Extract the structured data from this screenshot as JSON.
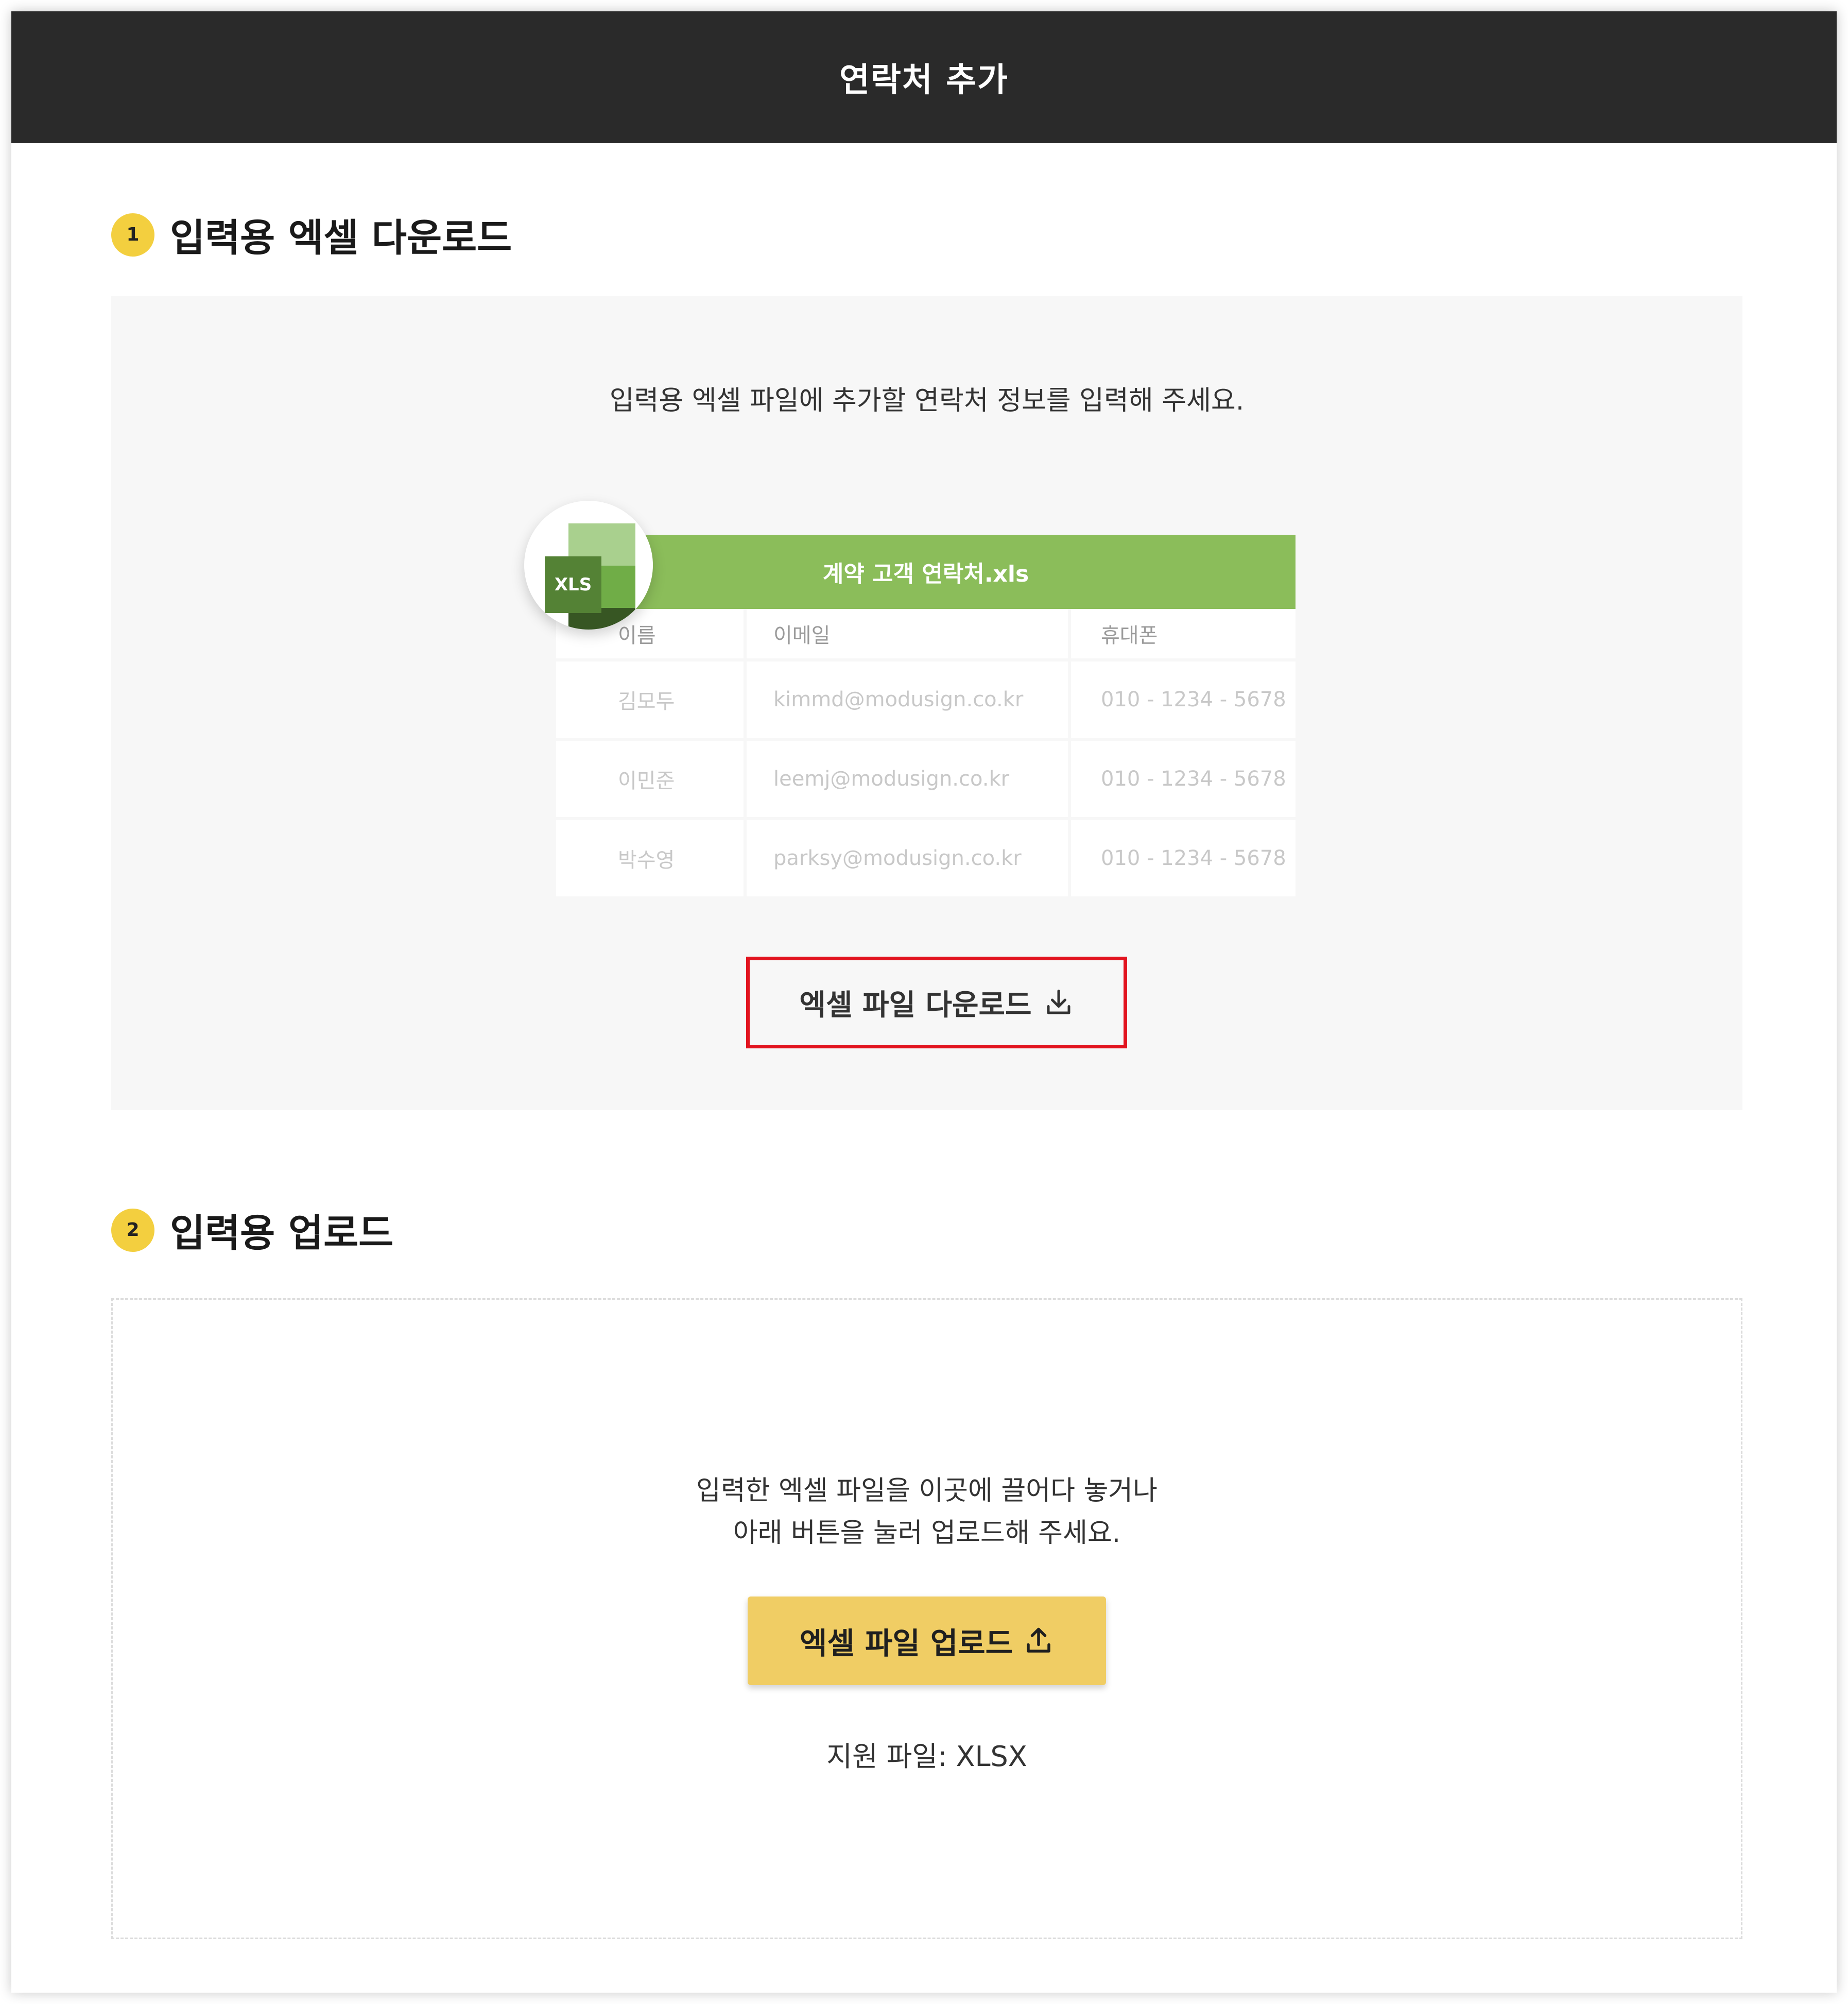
{
  "header": {
    "title": "연락처 추가"
  },
  "section1": {
    "step": "1",
    "title": "입력용 엑셀 다운로드",
    "description": "입력용 엑셀 파일에 추가할 연락처 정보를 입력해 주세요.",
    "preview": {
      "badge": "XLS",
      "filename": "계약 고객 연락처.xls",
      "columns": [
        "이름",
        "이메일",
        "휴대폰"
      ],
      "rows": [
        [
          "김모두",
          "kimmd@modusign.co.kr",
          "010 - 1234 - 5678"
        ],
        [
          "이민준",
          "leemj@modusign.co.kr",
          "010 - 1234 - 5678"
        ],
        [
          "박수영",
          "parksy@modusign.co.kr",
          "010 - 1234 - 5678"
        ]
      ]
    },
    "download_button": {
      "label": "엑셀 파일 다운로드",
      "icon": "download-icon"
    }
  },
  "section2": {
    "step": "2",
    "title": "입력용 업로드",
    "description_line1": "입력한 엑셀 파일을 이곳에 끌어다 놓거나",
    "description_line2": "아래 버튼을 눌러 업로드해 주세요.",
    "upload_button": {
      "label": "엑셀 파일 업로드",
      "icon": "upload-icon"
    },
    "support": "지원 파일: XLSX"
  },
  "colors": {
    "header_bg": "#2a2a2a",
    "step_badge": "#f3cf3f",
    "excel_green": "#8bbd5a",
    "highlight_border": "#e2141f",
    "upload_button": "#f0cd64"
  }
}
